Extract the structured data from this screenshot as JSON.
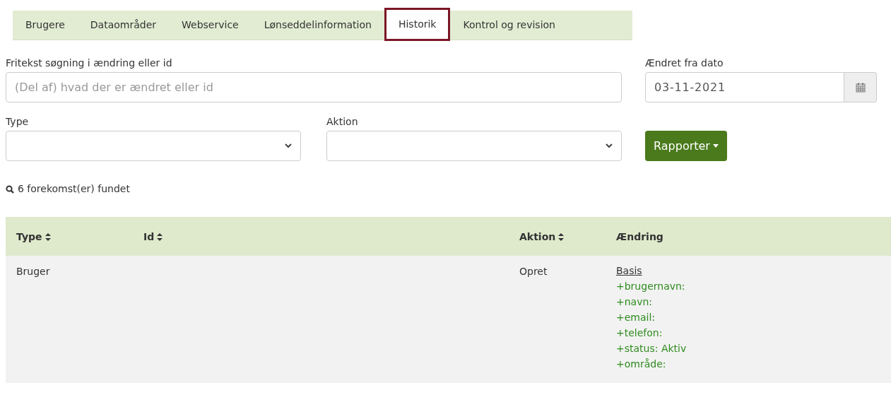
{
  "tabs": [
    {
      "label": "Brugere",
      "selected": false
    },
    {
      "label": "Dataområder",
      "selected": false
    },
    {
      "label": "Webservice",
      "selected": false
    },
    {
      "label": "Lønseddelinformation",
      "selected": false
    },
    {
      "label": "Historik",
      "selected": true
    },
    {
      "label": "Kontrol og revision",
      "selected": false
    }
  ],
  "search": {
    "label": "Fritekst søgning i ændring eller id",
    "placeholder": "(Del af) hvad der er ændret eller id"
  },
  "date": {
    "label": "Ændret fra dato",
    "value": "03-11-2021"
  },
  "type_select": {
    "label": "Type"
  },
  "action_select": {
    "label": "Aktion"
  },
  "report_button": {
    "label": "Rapporter"
  },
  "result_count": "6 forekomst(er) fundet",
  "table": {
    "columns": [
      {
        "label": "Type",
        "sortable": true
      },
      {
        "label": "Id",
        "sortable": true
      },
      {
        "label": "Aktion",
        "sortable": true
      },
      {
        "label": "Ændring",
        "sortable": false
      }
    ],
    "rows": [
      {
        "type": "Bruger",
        "aktion": "Opret",
        "changes": [
          {
            "kind": "link",
            "text": "Basis"
          },
          {
            "kind": "added",
            "text": "+brugernavn:"
          },
          {
            "kind": "added",
            "text": "+navn:"
          },
          {
            "kind": "added",
            "text": "+email:"
          },
          {
            "kind": "added",
            "text": "+telefon:"
          },
          {
            "kind": "added",
            "text": "+status: Aktiv"
          },
          {
            "kind": "added",
            "text": "+område:"
          }
        ]
      }
    ]
  }
}
